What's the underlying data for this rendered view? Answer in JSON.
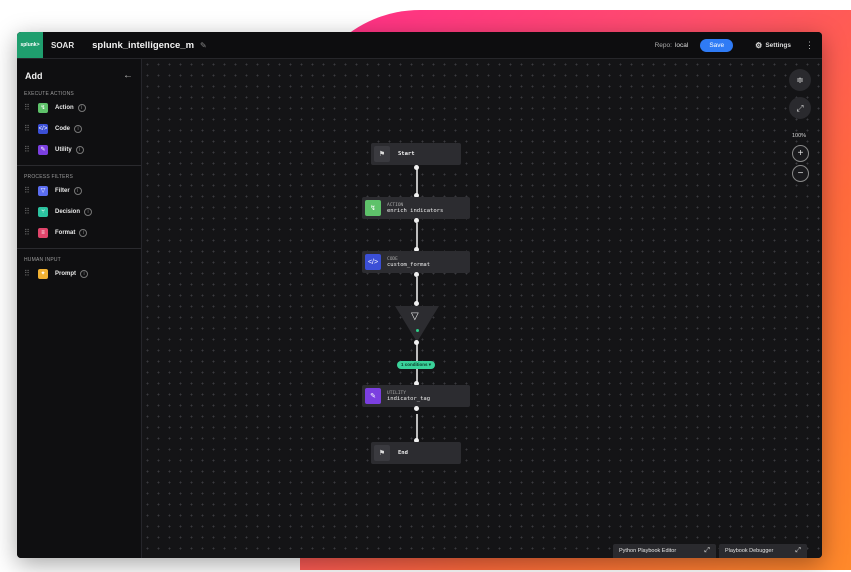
{
  "colors": {
    "accent_save": "#2f7bf5",
    "logo_bg": "#1f9e6e",
    "action": "#5ec26a",
    "code": "#3b4fd6",
    "utility": "#7b3fe0",
    "filter": "#5b6df0",
    "decision": "#2cc3a0",
    "format": "#e0456b",
    "prompt": "#f2b233",
    "pill": "#3ad29a"
  },
  "topbar": {
    "logo_text": "splunk>",
    "app_name": "SOAR",
    "playbook_name": "splunk_intelligence_m",
    "repo_label": "Repo:",
    "repo_value": "local",
    "save_label": "Save",
    "settings_label": "Settings"
  },
  "sidebar": {
    "title": "Add",
    "sections": [
      {
        "heading": "EXECUTE ACTIONS",
        "items": [
          {
            "label": "Action",
            "icon": "action-icon"
          },
          {
            "label": "Code",
            "icon": "code-icon"
          },
          {
            "label": "Utility",
            "icon": "utility-icon"
          }
        ]
      },
      {
        "heading": "PROCESS FILTERS",
        "items": [
          {
            "label": "Filter",
            "icon": "filter-icon"
          },
          {
            "label": "Decision",
            "icon": "decision-icon"
          },
          {
            "label": "Format",
            "icon": "format-icon"
          }
        ]
      },
      {
        "heading": "HUMAN INPUT",
        "items": [
          {
            "label": "Prompt",
            "icon": "prompt-icon"
          }
        ]
      }
    ]
  },
  "canvas": {
    "nodes": {
      "start": {
        "label": "Start"
      },
      "action": {
        "type": "ACTION",
        "name": "enrich indicators"
      },
      "code": {
        "type": "CODE",
        "name": "custom_format"
      },
      "utility": {
        "type": "UTILITY",
        "name": "indicator_tag"
      },
      "end": {
        "label": "End"
      }
    },
    "filter_pill": "1 ​conditions ▾",
    "zoom_level": "100%"
  },
  "bottom_tabs": {
    "python_editor": "Python Playbook Editor",
    "debugger": "Playbook Debugger"
  }
}
